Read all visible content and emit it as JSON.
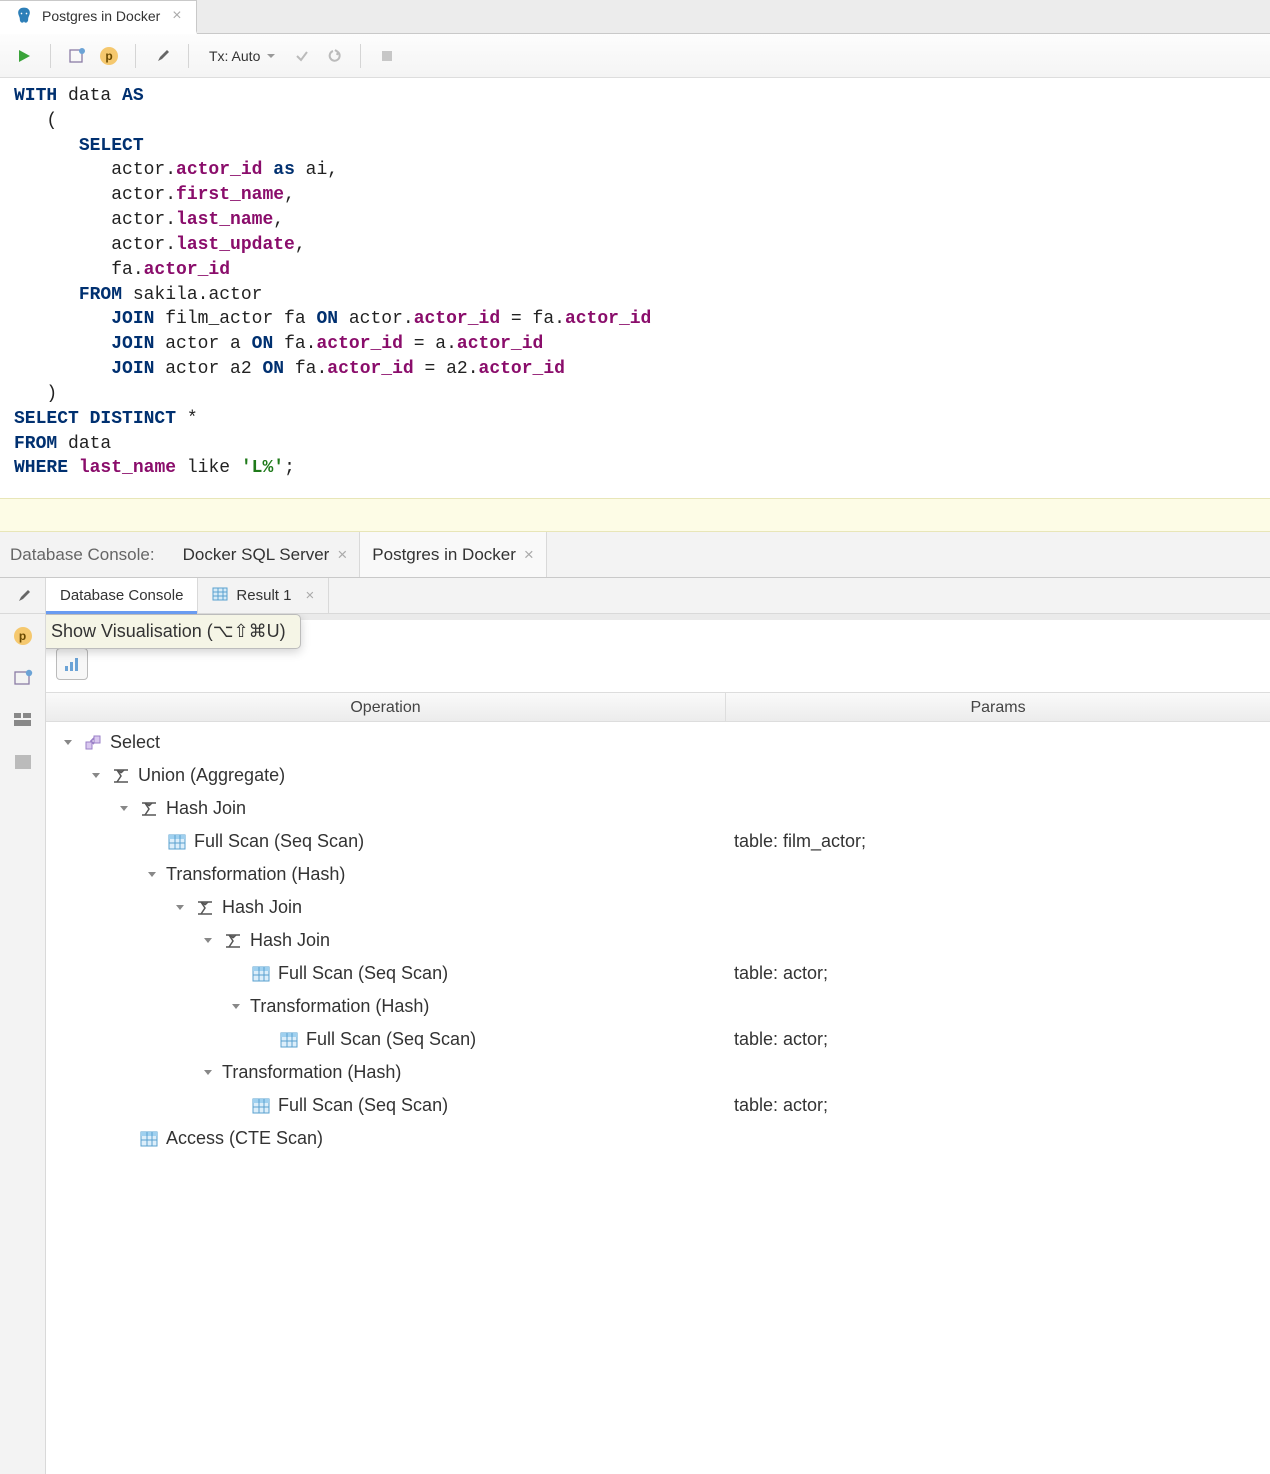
{
  "editor_tab": {
    "title": "Postgres in Docker"
  },
  "toolbar": {
    "tx_label": "Tx: Auto"
  },
  "code_tokens": [
    {
      "indent": 0,
      "parts": [
        {
          "t": "WITH",
          "c": "kw"
        },
        {
          "t": " data ",
          "c": ""
        },
        {
          "t": "AS",
          "c": "kw"
        }
      ]
    },
    {
      "indent": 1,
      "parts": [
        {
          "t": "(",
          "c": ""
        }
      ]
    },
    {
      "indent": 2,
      "parts": [
        {
          "t": "SELECT",
          "c": "kw"
        }
      ]
    },
    {
      "indent": 3,
      "parts": [
        {
          "t": "actor.",
          "c": ""
        },
        {
          "t": "actor_id",
          "c": "fld"
        },
        {
          "t": " ",
          "c": ""
        },
        {
          "t": "as",
          "c": "kw"
        },
        {
          "t": " ai,",
          "c": ""
        }
      ]
    },
    {
      "indent": 3,
      "parts": [
        {
          "t": "actor.",
          "c": ""
        },
        {
          "t": "first_name",
          "c": "fld"
        },
        {
          "t": ",",
          "c": ""
        }
      ]
    },
    {
      "indent": 3,
      "parts": [
        {
          "t": "actor.",
          "c": ""
        },
        {
          "t": "last_name",
          "c": "fld"
        },
        {
          "t": ",",
          "c": ""
        }
      ]
    },
    {
      "indent": 3,
      "parts": [
        {
          "t": "actor.",
          "c": ""
        },
        {
          "t": "last_update",
          "c": "fld"
        },
        {
          "t": ",",
          "c": ""
        }
      ]
    },
    {
      "indent": 3,
      "parts": [
        {
          "t": "fa.",
          "c": ""
        },
        {
          "t": "actor_id",
          "c": "fld"
        }
      ]
    },
    {
      "indent": 2,
      "parts": [
        {
          "t": "FROM",
          "c": "kw"
        },
        {
          "t": " sakila.actor",
          "c": ""
        }
      ]
    },
    {
      "indent": 3,
      "parts": [
        {
          "t": "JOIN",
          "c": "kw"
        },
        {
          "t": " film_actor fa ",
          "c": ""
        },
        {
          "t": "ON",
          "c": "kw"
        },
        {
          "t": " actor.",
          "c": ""
        },
        {
          "t": "actor_id",
          "c": "fld"
        },
        {
          "t": " = fa.",
          "c": ""
        },
        {
          "t": "actor_id",
          "c": "fld"
        }
      ]
    },
    {
      "indent": 3,
      "parts": [
        {
          "t": "JOIN",
          "c": "kw"
        },
        {
          "t": " actor a ",
          "c": ""
        },
        {
          "t": "ON",
          "c": "kw"
        },
        {
          "t": " fa.",
          "c": ""
        },
        {
          "t": "actor_id",
          "c": "fld"
        },
        {
          "t": " = a.",
          "c": ""
        },
        {
          "t": "actor_id",
          "c": "fld"
        }
      ]
    },
    {
      "indent": 3,
      "parts": [
        {
          "t": "JOIN",
          "c": "kw"
        },
        {
          "t": " actor a2 ",
          "c": ""
        },
        {
          "t": "ON",
          "c": "kw"
        },
        {
          "t": " fa.",
          "c": ""
        },
        {
          "t": "actor_id",
          "c": "fld"
        },
        {
          "t": " = a2.",
          "c": ""
        },
        {
          "t": "actor_id",
          "c": "fld"
        }
      ]
    },
    {
      "indent": 1,
      "parts": [
        {
          "t": ")",
          "c": ""
        }
      ]
    },
    {
      "indent": 0,
      "parts": [
        {
          "t": "SELECT",
          "c": "kw"
        },
        {
          "t": " ",
          "c": ""
        },
        {
          "t": "DISTINCT",
          "c": "kw"
        },
        {
          "t": " *",
          "c": ""
        }
      ]
    },
    {
      "indent": 0,
      "parts": [
        {
          "t": "FROM",
          "c": "kw"
        },
        {
          "t": " data",
          "c": ""
        }
      ]
    },
    {
      "indent": 0,
      "parts": [
        {
          "t": "WHERE",
          "c": "kw"
        },
        {
          "t": " ",
          "c": ""
        },
        {
          "t": "last_name",
          "c": "fld"
        },
        {
          "t": " like ",
          "c": ""
        },
        {
          "t": "'L%'",
          "c": "str"
        },
        {
          "t": ";",
          "c": ""
        }
      ]
    }
  ],
  "console": {
    "label": "Database Console:",
    "tabs": [
      {
        "label": "Docker SQL Server",
        "active": false
      },
      {
        "label": "Postgres in Docker",
        "active": true
      }
    ],
    "sub_tabs": [
      {
        "label": "Database Console",
        "active": true
      },
      {
        "label": "Result 1",
        "active": false,
        "closable": true
      }
    ]
  },
  "tooltip": {
    "text": "Show Visualisation (⌥⇧⌘U)"
  },
  "plan": {
    "headers": {
      "operation": "Operation",
      "params": "Params"
    },
    "rows": [
      {
        "indent": 0,
        "toggle": true,
        "icon": "select",
        "label": "Select",
        "params": ""
      },
      {
        "indent": 1,
        "toggle": true,
        "icon": "agg",
        "label": "Union (Aggregate)",
        "params": ""
      },
      {
        "indent": 2,
        "toggle": true,
        "icon": "agg",
        "label": "Hash Join",
        "params": ""
      },
      {
        "indent": 3,
        "toggle": false,
        "icon": "table",
        "label": "Full Scan (Seq Scan)",
        "params": "table: film_actor;"
      },
      {
        "indent": 3,
        "toggle": true,
        "icon": "none",
        "label": "Transformation (Hash)",
        "params": ""
      },
      {
        "indent": 4,
        "toggle": true,
        "icon": "agg",
        "label": "Hash Join",
        "params": ""
      },
      {
        "indent": 5,
        "toggle": true,
        "icon": "agg",
        "label": "Hash Join",
        "params": ""
      },
      {
        "indent": 6,
        "toggle": false,
        "icon": "table",
        "label": "Full Scan (Seq Scan)",
        "params": "table: actor;"
      },
      {
        "indent": 6,
        "toggle": true,
        "icon": "none",
        "label": "Transformation (Hash)",
        "params": ""
      },
      {
        "indent": 7,
        "toggle": false,
        "icon": "table",
        "label": "Full Scan (Seq Scan)",
        "params": "table: actor;"
      },
      {
        "indent": 5,
        "toggle": true,
        "icon": "none",
        "label": "Transformation (Hash)",
        "params": ""
      },
      {
        "indent": 6,
        "toggle": false,
        "icon": "table",
        "label": "Full Scan (Seq Scan)",
        "params": "table: actor;"
      },
      {
        "indent": 2,
        "toggle": false,
        "icon": "table",
        "label": "Access (CTE Scan)",
        "params": ""
      }
    ]
  }
}
